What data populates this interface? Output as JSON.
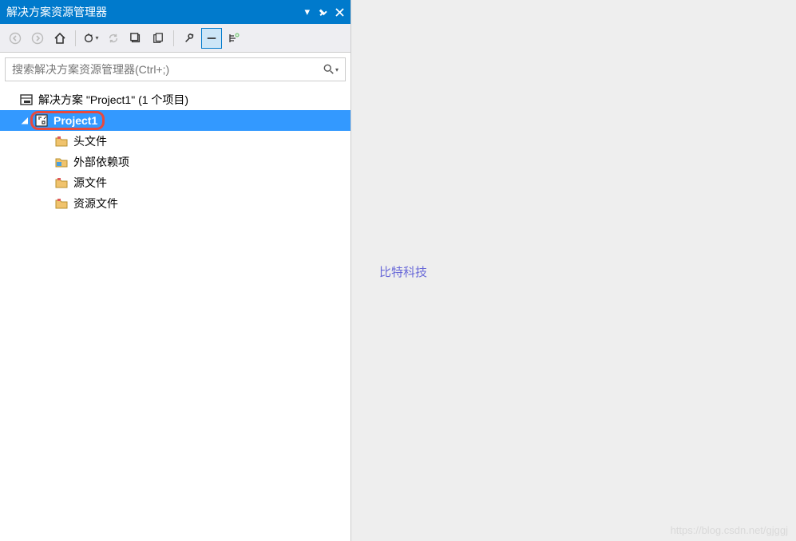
{
  "panel": {
    "title": "解决方案资源管理器"
  },
  "search": {
    "placeholder": "搜索解决方案资源管理器(Ctrl+;)"
  },
  "tree": {
    "solution_label": "解决方案 \"Project1\" (1 个项目)",
    "project_label": "Project1",
    "folders": [
      {
        "label": "头文件"
      },
      {
        "label": "外部依赖项"
      },
      {
        "label": "源文件"
      },
      {
        "label": "资源文件"
      }
    ]
  },
  "watermark": "比特科技",
  "watermark2": "https://blog.csdn.net/gjggj"
}
